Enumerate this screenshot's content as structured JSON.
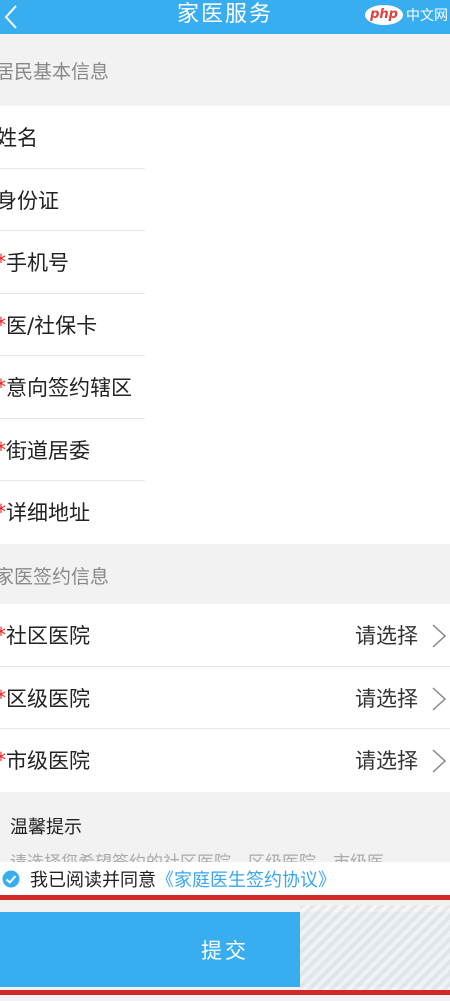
{
  "header": {
    "title": "家医服务",
    "back_icon": "chevron-left-icon",
    "watermark": {
      "php": "php",
      "text": "中文网"
    }
  },
  "resident_section": {
    "title": "居民基本信息",
    "rows": [
      {
        "label": "姓名",
        "required": false
      },
      {
        "label": "身份证",
        "required": false
      },
      {
        "label": "手机号",
        "required": true
      },
      {
        "label": "医/社保卡",
        "required": true
      },
      {
        "label": "意向签约辖区",
        "required": true
      },
      {
        "label": "街道居委",
        "required": true
      },
      {
        "label": "详细地址",
        "required": true
      }
    ]
  },
  "sign_section": {
    "title": "家医签约信息",
    "rows": [
      {
        "label": "社区医院",
        "required": true,
        "value": "请选择"
      },
      {
        "label": "区级医院",
        "required": true,
        "value": "请选择"
      },
      {
        "label": "市级医院",
        "required": true,
        "value": "请选择"
      }
    ]
  },
  "tips": {
    "title": "温馨提示",
    "text": "请选择您希望签约的社区医院、区级医院、市级医"
  },
  "agreement": {
    "checked": true,
    "text": "我已阅读并同意",
    "link": "《家庭医生签约协议》"
  },
  "submit_label": "提交",
  "required_mark": "*",
  "colors": {
    "primary": "#38aef0",
    "required": "#e22222",
    "link": "#3aa5f0"
  }
}
